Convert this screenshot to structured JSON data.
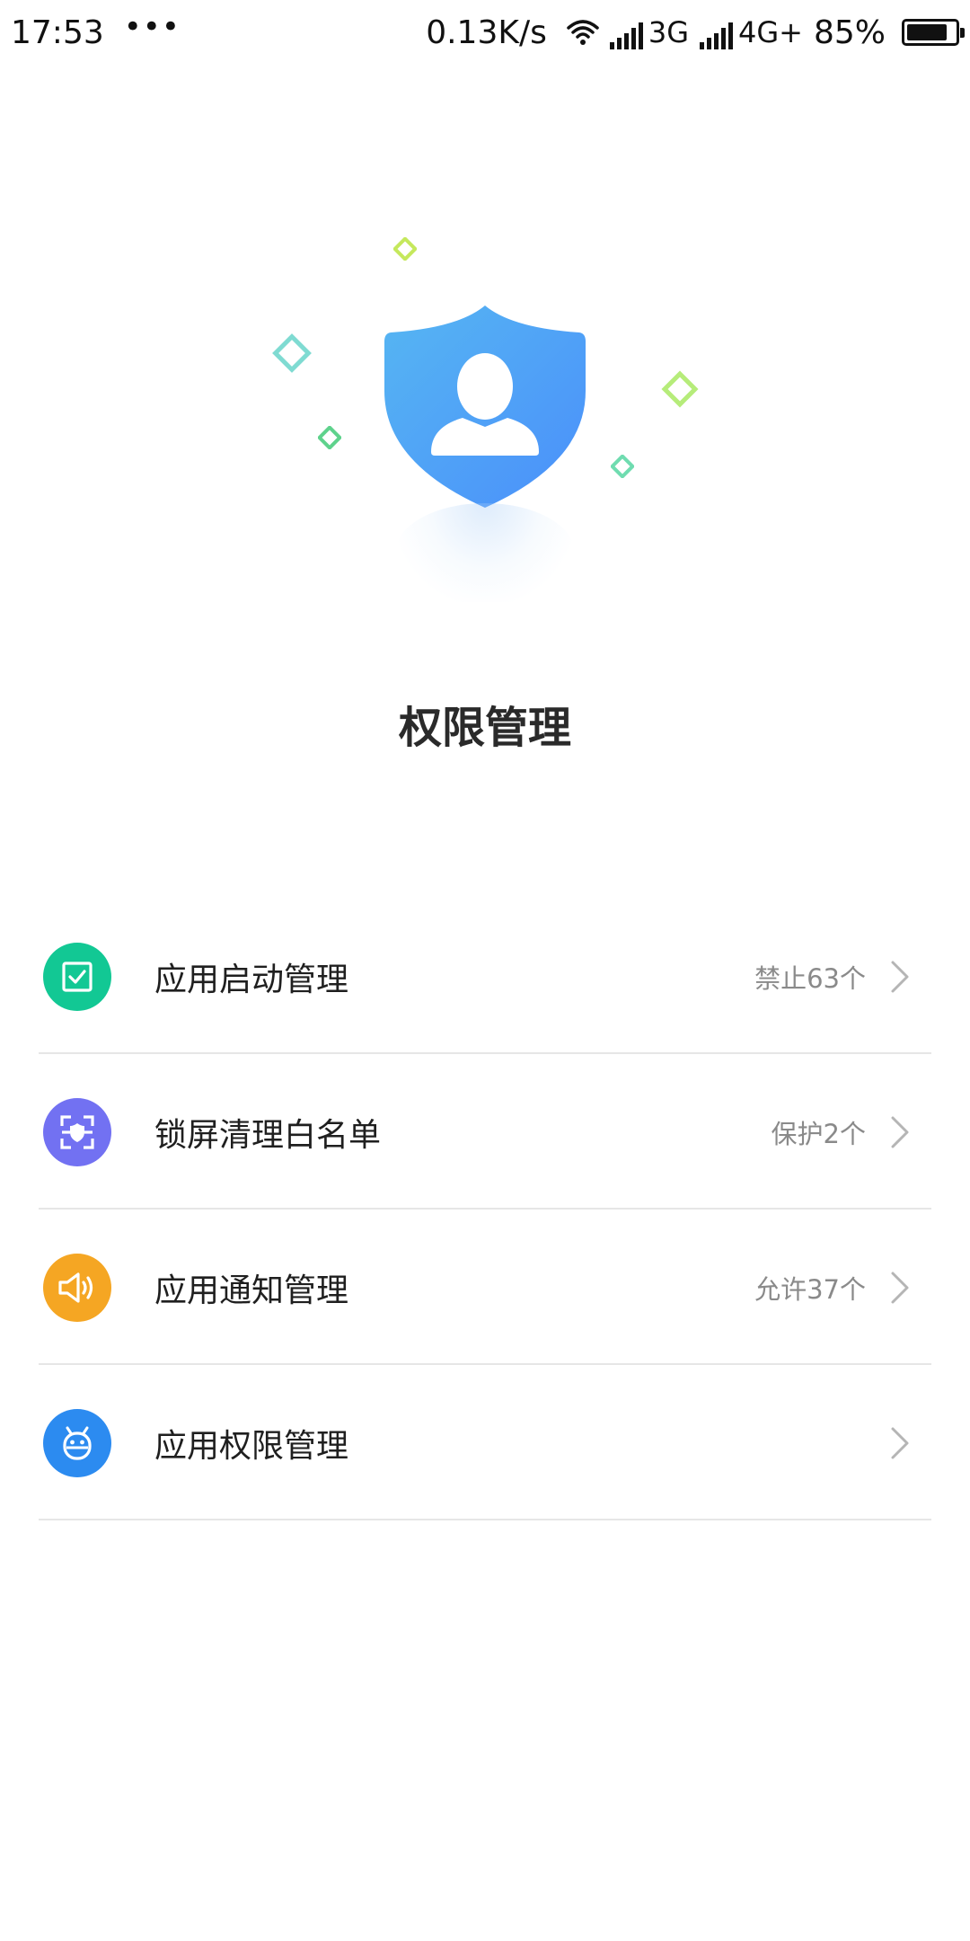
{
  "status_bar": {
    "time": "17:53",
    "dots": "•••",
    "speed": "0.13K/s",
    "net1": "3G",
    "net2": "4G+",
    "battery": "85%",
    "battery_level": 0.85
  },
  "page": {
    "title": "权限管理"
  },
  "colors": {
    "shield": "#4AA0F5",
    "startup": "#12C894",
    "whitelist": "#7271F2",
    "notify": "#F5A623",
    "permission": "#2C8BF0"
  },
  "menu": [
    {
      "label": "应用启动管理",
      "status": "禁止63个",
      "icon": "check-square-icon"
    },
    {
      "label": "锁屏清理白名单",
      "status": "保护2个",
      "icon": "lock-screen-shield-icon"
    },
    {
      "label": "应用通知管理",
      "status": "允许37个",
      "icon": "speaker-icon"
    },
    {
      "label": "应用权限管理",
      "status": "",
      "icon": "android-robot-icon"
    }
  ]
}
